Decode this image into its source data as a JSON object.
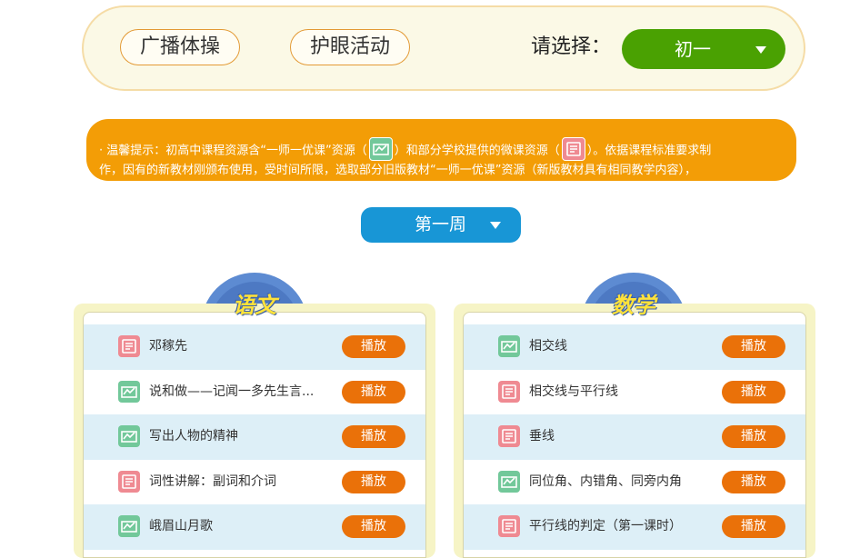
{
  "topbar": {
    "chips": [
      "广播体操",
      "护眼活动"
    ],
    "select_label": "请选择：",
    "grade": "初一"
  },
  "tip": {
    "part1": "· 温馨提示：初高中课程资源含“一师一优课”资源（",
    "part2": "）和部分学校提供的微课资源（",
    "part3": "）。依据课程标准要求制",
    "line2": "作，因有的新教材刚颁布使用，受时间所限，选取部分旧版教材“一师一优课”资源（新版教材具有相同教学内容），"
  },
  "week": "第一周",
  "subjects": [
    {
      "name": "语文",
      "items": [
        {
          "title": "邓稼先",
          "icon": "doc-icon",
          "play": "播放"
        },
        {
          "title": "说和做——记闻一多先生言...",
          "icon": "video-icon",
          "play": "播放"
        },
        {
          "title": "写出人物的精神",
          "icon": "video-icon",
          "play": "播放"
        },
        {
          "title": "词性讲解：副词和介词",
          "icon": "doc-icon",
          "play": "播放"
        },
        {
          "title": "峨眉山月歌",
          "icon": "video-icon",
          "play": "播放"
        }
      ]
    },
    {
      "name": "数学",
      "items": [
        {
          "title": "相交线",
          "icon": "video-icon",
          "play": "播放"
        },
        {
          "title": "相交线与平行线",
          "icon": "doc-icon",
          "play": "播放"
        },
        {
          "title": "垂线",
          "icon": "doc-icon",
          "play": "播放"
        },
        {
          "title": "同位角、内错角、同旁内角",
          "icon": "video-icon",
          "play": "播放"
        },
        {
          "title": "平行线的判定（第一课时）",
          "icon": "doc-icon",
          "play": "播放"
        }
      ]
    }
  ],
  "colors": {
    "grade_select": "#4aa102",
    "tip_banner": "#f39d06",
    "week_select": "#1896d6",
    "play_button": "#ea7109",
    "video_icon": "#72c89a",
    "doc_icon": "#ef8a92"
  }
}
